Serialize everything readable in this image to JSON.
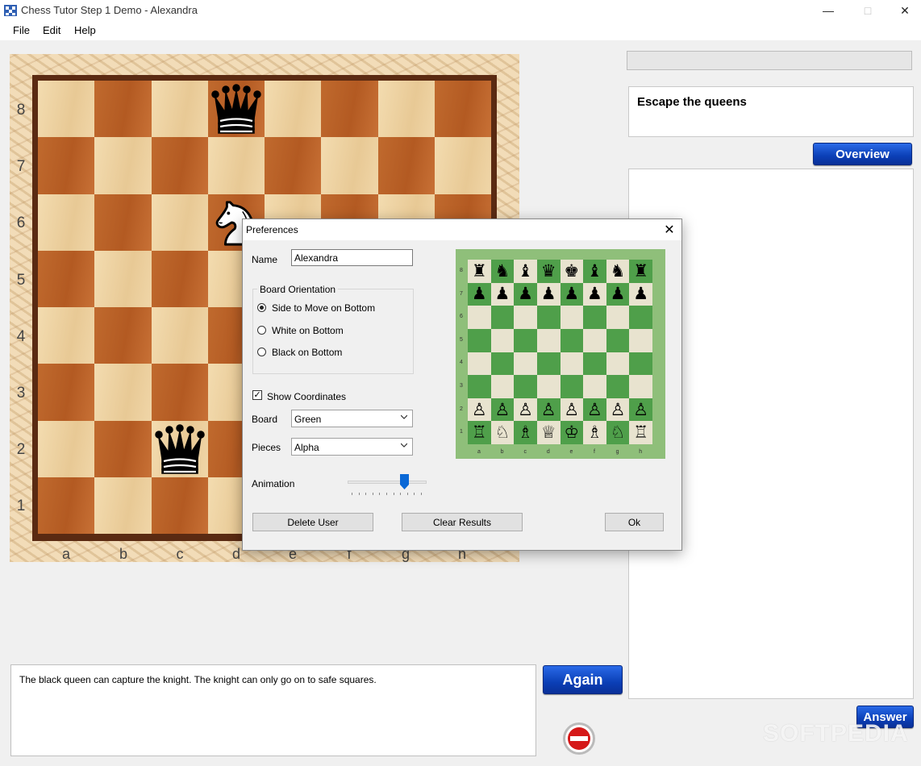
{
  "window": {
    "title": "Chess Tutor Step 1 Demo - Alexandra"
  },
  "menu": [
    "File",
    "Edit",
    "Help"
  ],
  "board": {
    "ranks": [
      "8",
      "7",
      "6",
      "5",
      "4",
      "3",
      "2",
      "1"
    ],
    "files": [
      "a",
      "b",
      "c",
      "d",
      "e",
      "f",
      "g",
      "h"
    ],
    "pieces": [
      {
        "square": "d8",
        "piece": "black-queen"
      },
      {
        "square": "d6",
        "piece": "white-knight"
      },
      {
        "square": "c2",
        "piece": "black-queen"
      }
    ]
  },
  "exercise": {
    "title": "Escape the queens"
  },
  "buttons": {
    "overview": "Overview",
    "answer": "Answer",
    "again": "Again"
  },
  "message": "The black queen can capture the knight. The knight can only go on to safe squares.",
  "watermark": "SOFTPEDIA",
  "dialog": {
    "title": "Preferences",
    "name_label": "Name",
    "name_value": "Alexandra",
    "orientation_label": "Board Orientation",
    "orientation_options": [
      "Side to Move on Bottom",
      "White on Bottom",
      "Black on Bottom"
    ],
    "orientation_selected": 0,
    "show_coordinates_label": "Show Coordinates",
    "show_coordinates_checked": true,
    "board_label": "Board",
    "board_value": "Green",
    "pieces_label": "Pieces",
    "pieces_value": "Alpha",
    "animation_label": "Animation",
    "animation_level": 0.75,
    "delete_user": "Delete User",
    "clear_results": "Clear Results",
    "ok": "Ok",
    "preview": {
      "ranks": [
        "8",
        "7",
        "6",
        "5",
        "4",
        "3",
        "2",
        "1"
      ],
      "files": [
        "a",
        "b",
        "c",
        "d",
        "e",
        "f",
        "g",
        "h"
      ],
      "rows": [
        [
          "♜",
          "♞",
          "♝",
          "♛",
          "♚",
          "♝",
          "♞",
          "♜"
        ],
        [
          "♟",
          "♟",
          "♟",
          "♟",
          "♟",
          "♟",
          "♟",
          "♟"
        ],
        [
          "",
          "",
          "",
          "",
          "",
          "",
          "",
          ""
        ],
        [
          "",
          "",
          "",
          "",
          "",
          "",
          "",
          ""
        ],
        [
          "",
          "",
          "",
          "",
          "",
          "",
          "",
          ""
        ],
        [
          "",
          "",
          "",
          "",
          "",
          "",
          "",
          ""
        ],
        [
          "♙",
          "♙",
          "♙",
          "♙",
          "♙",
          "♙",
          "♙",
          "♙"
        ],
        [
          "♖",
          "♘",
          "♗",
          "♕",
          "♔",
          "♗",
          "♘",
          "♖"
        ]
      ]
    }
  },
  "colors": {
    "accent_blue": "#0b3fb6",
    "board_dark": "#b35a22",
    "board_light": "#efd3a3",
    "preview_dark": "#4f9f4a",
    "preview_light": "#e8e3cf"
  }
}
